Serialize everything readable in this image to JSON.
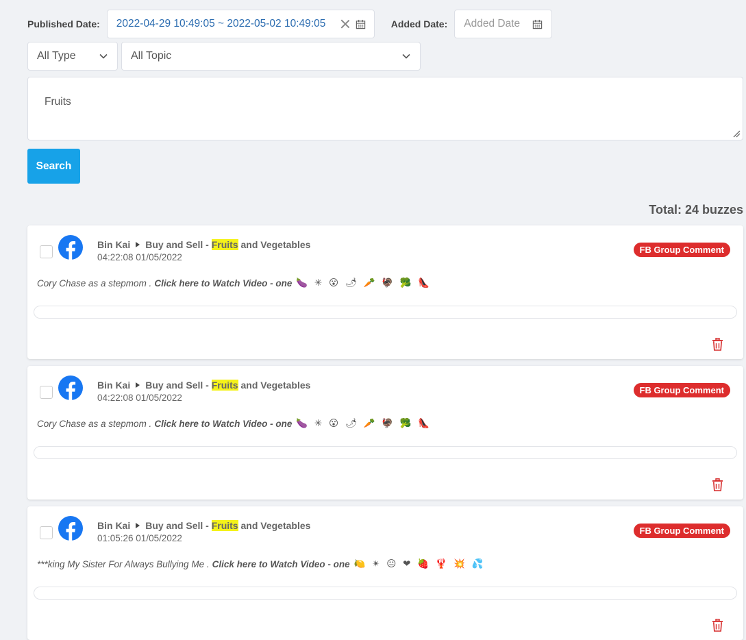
{
  "filters": {
    "published_label": "Published Date:",
    "published_value": "2022-04-29 10:49:05 ~ 2022-05-02 10:49:05",
    "added_label": "Added Date:",
    "added_placeholder": "Added Date",
    "type_value": "All Type",
    "topic_value": "All Topic"
  },
  "search": {
    "query": "Fruits",
    "button_label": "Search"
  },
  "total_label": "Total: 24 buzzes",
  "colors": {
    "accent": "#17a2e8",
    "badge": "#dd2d2d",
    "highlight": "#f4f21a",
    "facebook": "#1877f2"
  },
  "results": [
    {
      "author": "Bin Kai",
      "group_prefix": "Buy and Sell - ",
      "group_highlight": "Fruits",
      "group_suffix": " and Vegetables",
      "time": "04:22:08 01/05/2022",
      "badge": "FB Group Comment",
      "content_text": "Cory Chase as a stepmom . ",
      "content_link": "Click here to Watch Video - one",
      "emoji": "🍆 ✳ 😮 🌶 🥕 🦃 🥦 👠"
    },
    {
      "author": "Bin Kai",
      "group_prefix": "Buy and Sell - ",
      "group_highlight": "Fruits",
      "group_suffix": " and Vegetables",
      "time": "04:22:08 01/05/2022",
      "badge": "FB Group Comment",
      "content_text": "Cory Chase as a stepmom . ",
      "content_link": "Click here to Watch Video - one",
      "emoji": "🍆 ✳ 😮 🌶 🥕 🦃 🥦 👠"
    },
    {
      "author": "Bin Kai",
      "group_prefix": "Buy and Sell - ",
      "group_highlight": "Fruits",
      "group_suffix": " and Vegetables",
      "time": "01:05:26 01/05/2022",
      "badge": "FB Group Comment",
      "content_text": "***king My Sister For Always Bullying Me . ",
      "content_link": "Click here to Watch Video - one",
      "emoji": "🍋 ✴ 😐 ❤ 🍓 🦞 💥 💦"
    }
  ]
}
